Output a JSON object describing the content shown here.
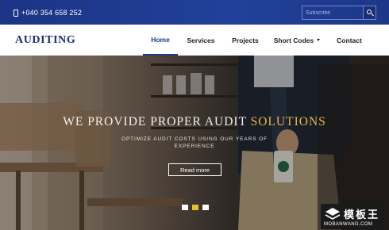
{
  "topbar": {
    "phone_icon": "phone-icon",
    "phone": "+040 354 658 252",
    "subscribe_placeholder": "Subscribe",
    "search_icon": "search-icon",
    "bg_color": "#1f3a8a"
  },
  "navbar": {
    "logo": "AUDITING",
    "items": [
      {
        "label": "Home",
        "active": true
      },
      {
        "label": "Services",
        "active": false
      },
      {
        "label": "Projects",
        "active": false
      },
      {
        "label": "Short Codes",
        "active": false,
        "dropdown": true
      },
      {
        "label": "Contact",
        "active": false
      }
    ],
    "dropdown_icon": "caret-down-icon",
    "accent_color": "#1f3a8a"
  },
  "hero": {
    "headline_main": "WE PROVIDE PROPER AUDIT ",
    "headline_accent": "SOLUTIONS",
    "accent_color": "#e6b84a",
    "subline": "OPTIMIZE AUDIT COSTS USING OUR YEARS OF EXPERIENCE",
    "button": "Read more",
    "slides_total": 3,
    "active_slide": 2,
    "dot_active_color": "#e6c32b"
  },
  "watermark": {
    "title": "模板王",
    "url": "MOBANWANG.COM"
  }
}
